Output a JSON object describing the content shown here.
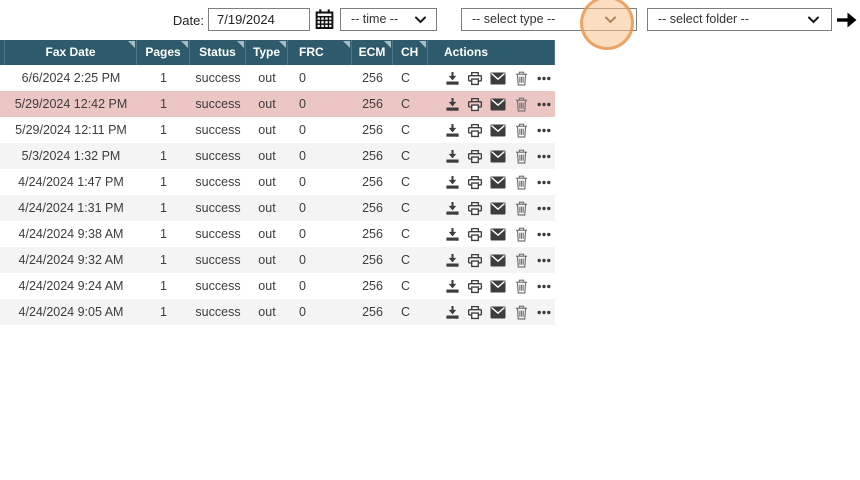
{
  "toolbar": {
    "date_label": "Date:",
    "date_value": "7/19/2024",
    "time_placeholder": "-- time --",
    "type_placeholder": "-- select type --",
    "folder_placeholder": "-- select folder --"
  },
  "table": {
    "columns": [
      "Fax Date",
      "Pages",
      "Status",
      "Type",
      "FRC",
      "ECM",
      "CH",
      "Actions"
    ],
    "rows": [
      {
        "fax_date": "6/6/2024 2:25 PM",
        "pages": "1",
        "status": "success",
        "type": "out",
        "frc": "0",
        "ecm": "256",
        "ch": "C",
        "highlighted": false
      },
      {
        "fax_date": "5/29/2024 12:42 PM",
        "pages": "1",
        "status": "success",
        "type": "out",
        "frc": "0",
        "ecm": "256",
        "ch": "C",
        "highlighted": true
      },
      {
        "fax_date": "5/29/2024 12:11 PM",
        "pages": "1",
        "status": "success",
        "type": "out",
        "frc": "0",
        "ecm": "256",
        "ch": "C",
        "highlighted": false
      },
      {
        "fax_date": "5/3/2024 1:32 PM",
        "pages": "1",
        "status": "success",
        "type": "out",
        "frc": "0",
        "ecm": "256",
        "ch": "C",
        "highlighted": false
      },
      {
        "fax_date": "4/24/2024 1:47 PM",
        "pages": "1",
        "status": "success",
        "type": "out",
        "frc": "0",
        "ecm": "256",
        "ch": "C",
        "highlighted": false
      },
      {
        "fax_date": "4/24/2024 1:31 PM",
        "pages": "1",
        "status": "success",
        "type": "out",
        "frc": "0",
        "ecm": "256",
        "ch": "C",
        "highlighted": false
      },
      {
        "fax_date": "4/24/2024 9:38 AM",
        "pages": "1",
        "status": "success",
        "type": "out",
        "frc": "0",
        "ecm": "256",
        "ch": "C",
        "highlighted": false
      },
      {
        "fax_date": "4/24/2024 9:32 AM",
        "pages": "1",
        "status": "success",
        "type": "out",
        "frc": "0",
        "ecm": "256",
        "ch": "C",
        "highlighted": false
      },
      {
        "fax_date": "4/24/2024 9:24 AM",
        "pages": "1",
        "status": "success",
        "type": "out",
        "frc": "0",
        "ecm": "256",
        "ch": "C",
        "highlighted": false
      },
      {
        "fax_date": "4/24/2024 9:05 AM",
        "pages": "1",
        "status": "success",
        "type": "out",
        "frc": "0",
        "ecm": "256",
        "ch": "C",
        "highlighted": false
      }
    ]
  },
  "row_actions": [
    "download",
    "print",
    "email",
    "delete",
    "more"
  ],
  "colors": {
    "header_bg": "#2e5b6c",
    "header_separator": "#4e7585",
    "row_alt": "#f4f4f4",
    "row_highlight": "#ecc6c2",
    "highlight_circle_fill": "#f7c18c",
    "highlight_circle_ring": "#e7964e"
  }
}
